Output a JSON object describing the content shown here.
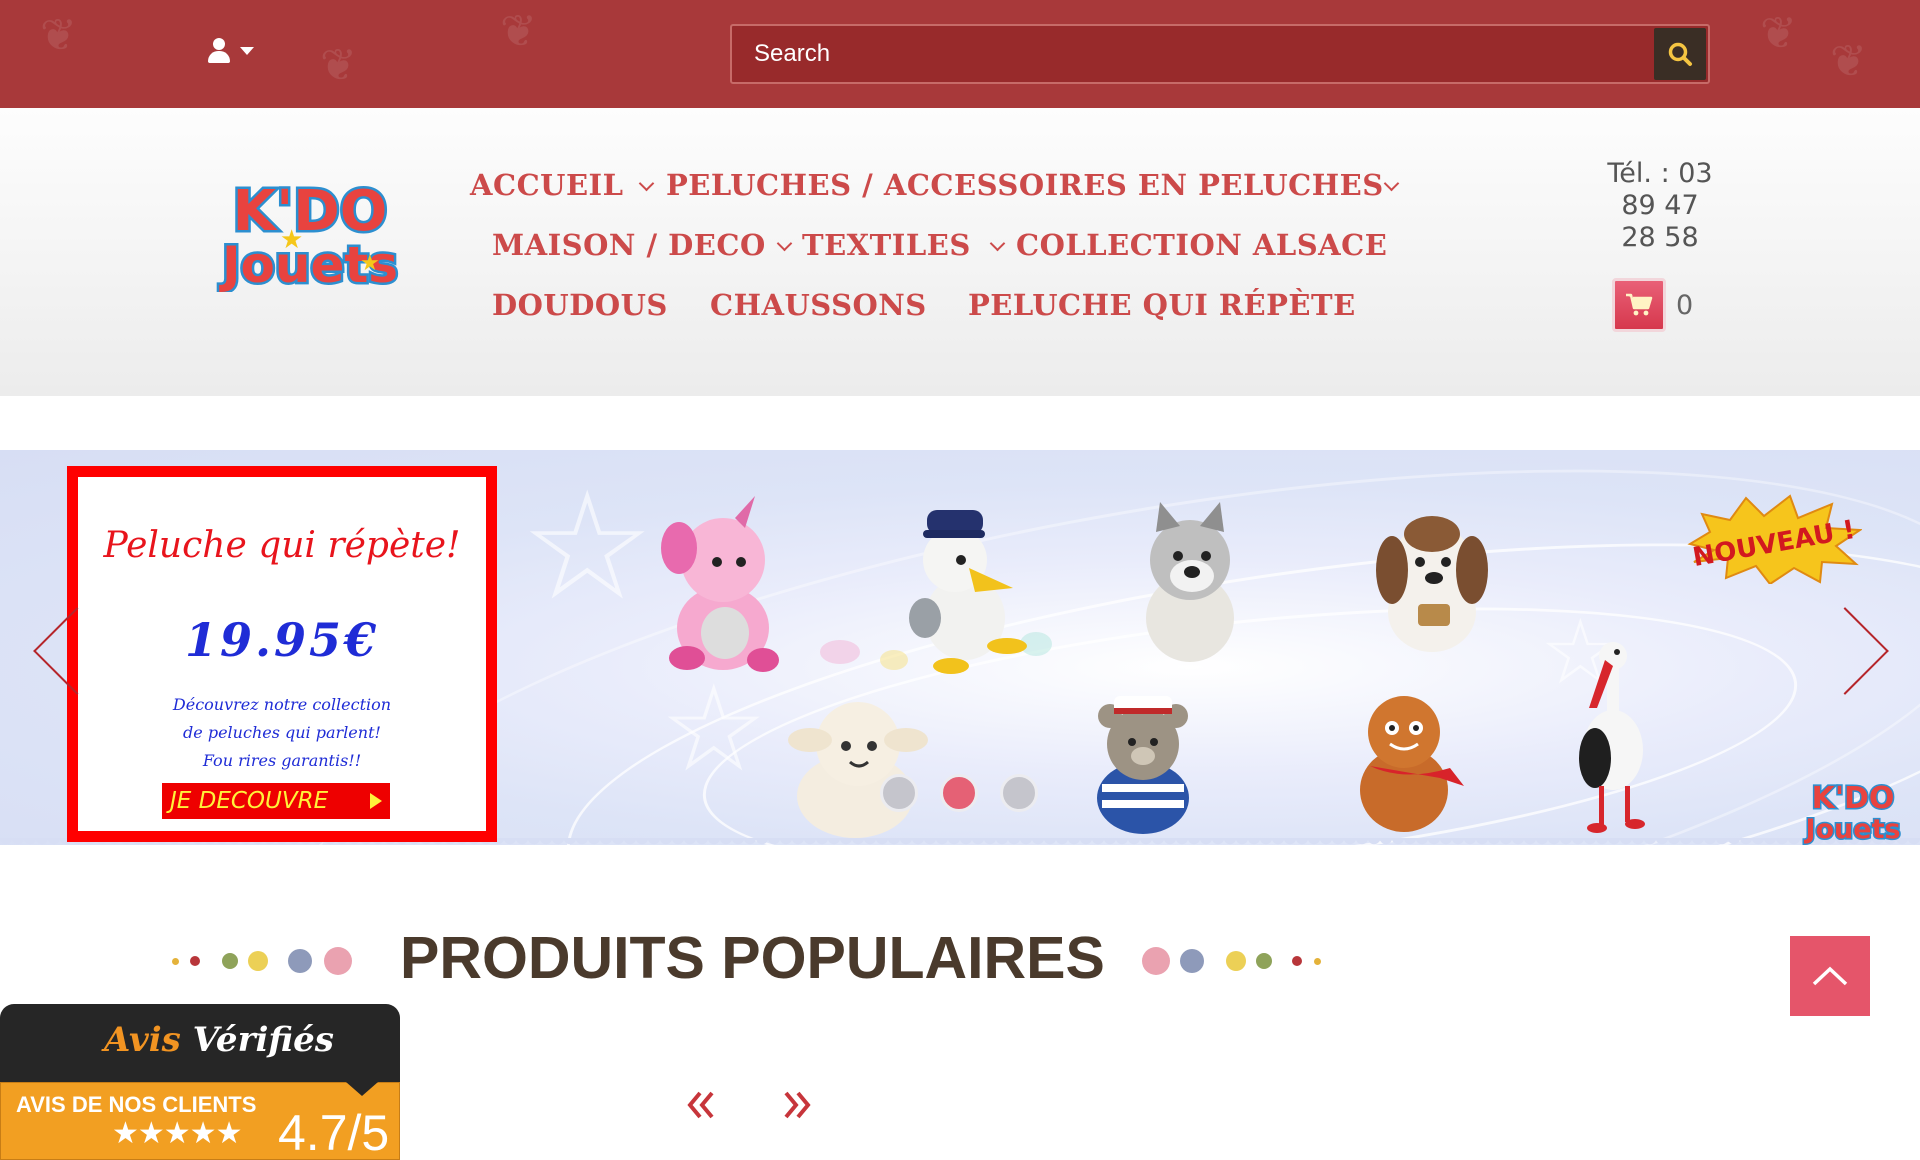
{
  "topbar": {
    "search_placeholder": "Search",
    "user_icon": "user-icon",
    "search_icon": "search-icon"
  },
  "brand": {
    "logo_line1": "K'DO",
    "logo_line2": "Jouets"
  },
  "nav": {
    "items": [
      {
        "label": "ACCUEIL",
        "has_submenu": true
      },
      {
        "label": "PELUCHES / ACCESSOIRES EN PELUCHES",
        "has_submenu": true
      },
      {
        "label": "MAISON / DECO",
        "has_submenu": true
      },
      {
        "label": "TEXTILES",
        "has_submenu": true
      },
      {
        "label": "COLLECTION ALSACE",
        "has_submenu": false
      },
      {
        "label": "DOUDOUS",
        "has_submenu": false
      },
      {
        "label": "CHAUSSONS",
        "has_submenu": false
      },
      {
        "label": "PELUCHE QUI RÉPÈTE",
        "has_submenu": false
      }
    ]
  },
  "contact": {
    "phone_line1": "Tél. : 03",
    "phone_line2": "89 47",
    "phone_line3": "28 58"
  },
  "cart": {
    "count": "0",
    "icon": "cart-icon"
  },
  "slider": {
    "promo_title": "Peluche qui répète!",
    "promo_price": "19.95€",
    "promo_text_line1": "Découvrez notre collection",
    "promo_text_line2": "de peluches qui parlent!",
    "promo_text_line3": "Fou rires garantis!!",
    "promo_button": "JE DECOUVRE",
    "badge": "NOUVEAU !",
    "small_logo_line1": "K'DO",
    "small_logo_line2": "Jouets",
    "slide_count": 3,
    "active_slide": 2
  },
  "popular": {
    "title": "PRODUITS POPULAIRES"
  },
  "reviews": {
    "brand_part1": "Avis",
    "brand_part2": "Vérifiés",
    "label": "AVIS DE NOS CLIENTS",
    "stars": "★★★★★",
    "score": "4.7/5"
  },
  "colors": {
    "topbar": "#a8393a",
    "nav_text": "#cc4a4a",
    "accent_pink": "#e5556a",
    "title_brown": "#4a3a2c",
    "reviews_orange": "#f29f22"
  }
}
